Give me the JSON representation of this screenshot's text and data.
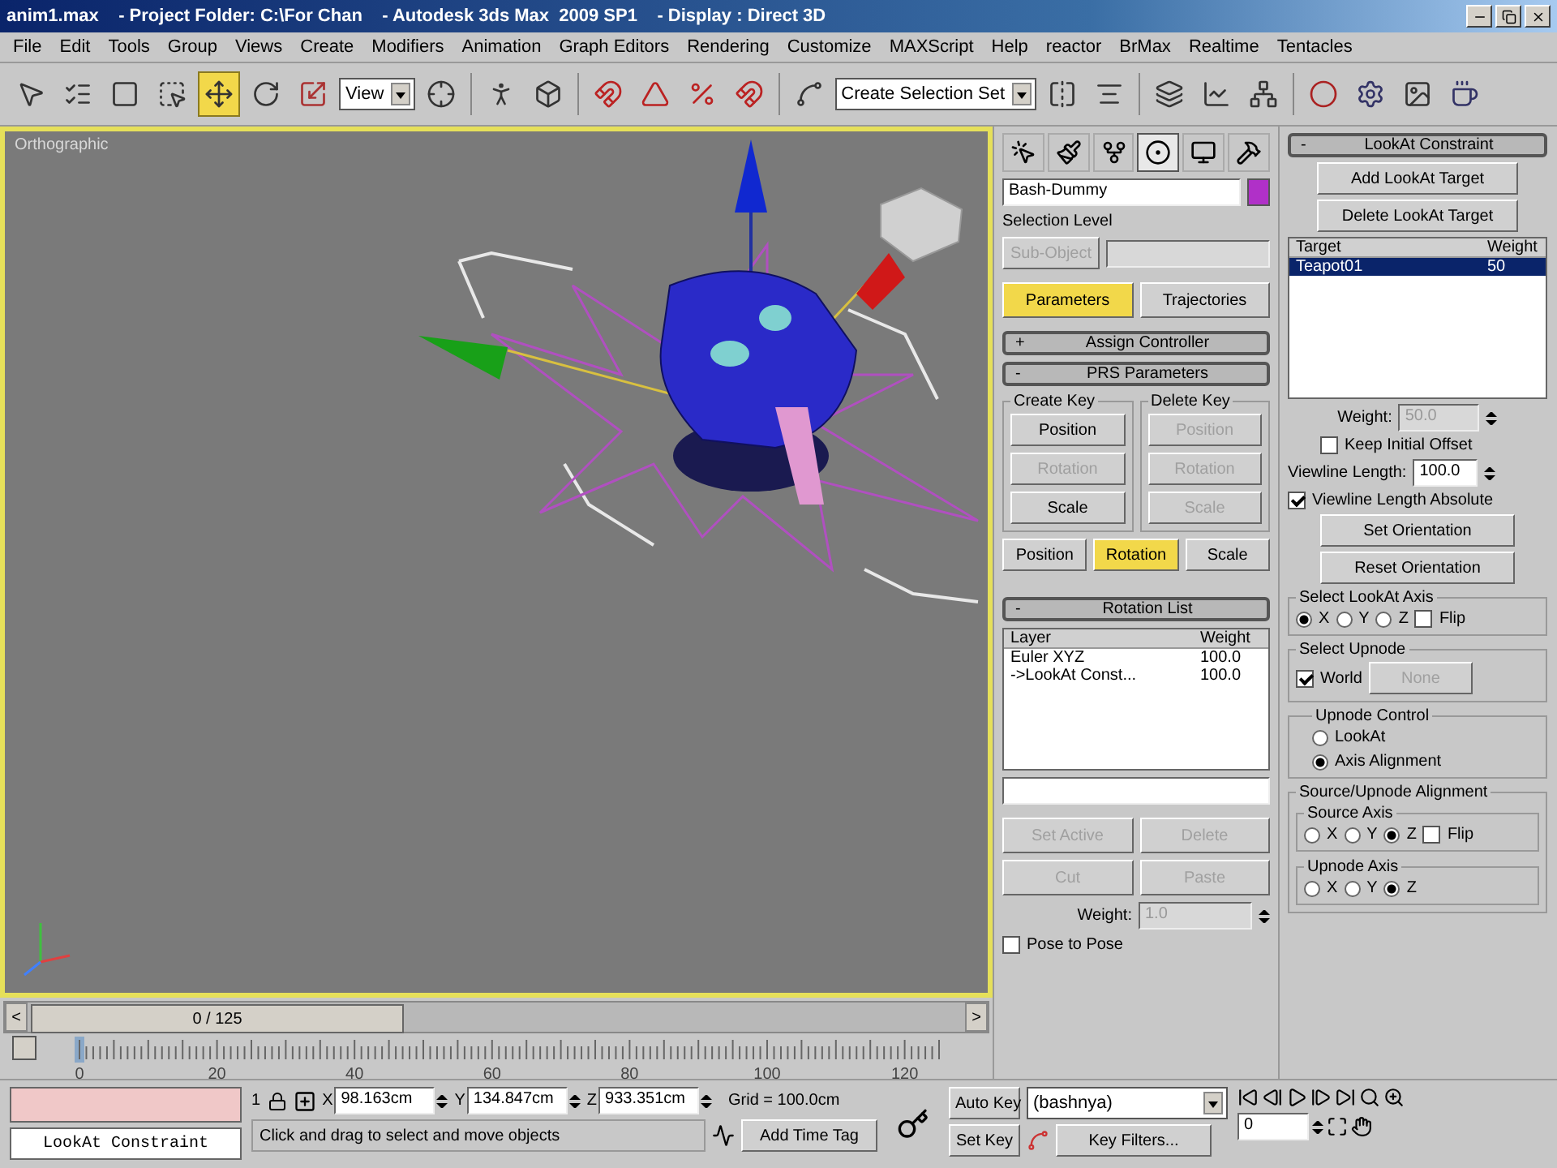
{
  "window": {
    "title": "anim1.max    - Project Folder: C:\\For Chan    - Autodesk 3ds Max  2009 SP1    - Display : Direct 3D"
  },
  "menu": [
    "File",
    "Edit",
    "Tools",
    "Group",
    "Views",
    "Create",
    "Modifiers",
    "Animation",
    "Graph Editors",
    "Rendering",
    "Customize",
    "MAXScript",
    "Help",
    "reactor",
    "BrMax",
    "Realtime",
    "Tentacles"
  ],
  "toolbar": [
    {
      "kind": "tool",
      "selected": false
    },
    {
      "kind": "tool",
      "selected": false
    },
    {
      "kind": "tool",
      "selected": false
    },
    {
      "kind": "tool",
      "selected": false
    },
    {
      "kind": "tool",
      "selected": true
    },
    {
      "kind": "tool",
      "selected": false
    },
    {
      "kind": "tool",
      "selected": false
    },
    {
      "kind": "dropdown",
      "value": "View"
    },
    {
      "kind": "tool",
      "selected": false
    },
    {
      "kind": "separator"
    },
    {
      "kind": "tool",
      "selected": false
    },
    {
      "kind": "tool",
      "selected": false
    },
    {
      "kind": "separator"
    },
    {
      "kind": "tool",
      "selected": false
    },
    {
      "kind": "tool",
      "selected": false
    },
    {
      "kind": "tool",
      "selected": false
    },
    {
      "kind": "tool",
      "selected": false
    },
    {
      "kind": "separator"
    },
    {
      "kind": "tool",
      "selected": false
    },
    {
      "kind": "dropdown",
      "value": "Create Selection Set"
    },
    {
      "kind": "tool",
      "selected": false
    },
    {
      "kind": "tool",
      "selected": false
    },
    {
      "kind": "separator"
    },
    {
      "kind": "tool",
      "selected": false
    },
    {
      "kind": "tool",
      "selected": false
    },
    {
      "kind": "tool",
      "selected": false
    },
    {
      "kind": "separator"
    },
    {
      "kind": "tool",
      "selected": false
    },
    {
      "kind": "tool",
      "selected": false
    },
    {
      "kind": "tool",
      "selected": false
    },
    {
      "kind": "tool",
      "selected": false
    }
  ],
  "viewport": {
    "label": "Orthographic"
  },
  "time_slider": {
    "label": "0 / 125",
    "level": 0,
    "prev": "<",
    "next": ">"
  },
  "track_bar": {
    "ticks": [
      "0",
      "20",
      "40",
      "60",
      "80",
      "100",
      "120"
    ]
  },
  "command_panel": {
    "tabs": [
      {
        "selected": false
      },
      {
        "selected": false
      },
      {
        "selected": false
      },
      {
        "selected": true
      },
      {
        "selected": false
      },
      {
        "selected": false
      }
    ],
    "object_name": "Bash-Dummy",
    "selection_level": "Selection Level",
    "sub_object": "Sub-Object",
    "modes": [
      {
        "label": "Parameters",
        "selected": true
      },
      {
        "label": "Trajectories",
        "selected": false
      }
    ],
    "assign_controller": {
      "sign": "+",
      "title": "Assign Controller"
    },
    "prs": {
      "sign": "-",
      "title": "PRS Parameters",
      "groups": [
        {
          "title": "Create Key",
          "buttons": [
            {
              "label": "Position",
              "disabled": false
            },
            {
              "label": "Rotation",
              "disabled": true
            },
            {
              "label": "Scale",
              "disabled": false
            }
          ]
        },
        {
          "title": "Delete Key",
          "buttons": [
            {
              "label": "Position",
              "disabled": true
            },
            {
              "label": "Rotation",
              "disabled": true
            },
            {
              "label": "Scale",
              "disabled": true
            }
          ]
        }
      ],
      "tabs": [
        {
          "label": "Position",
          "selected": false
        },
        {
          "label": "Rotation",
          "selected": true
        },
        {
          "label": "Scale",
          "selected": false
        }
      ]
    },
    "rotation_list": {
      "sign": "-",
      "title": "Rotation List",
      "columns": [
        "Layer",
        "Weight"
      ],
      "rows": [
        {
          "layer": "Euler XYZ",
          "weight": "100.0"
        },
        {
          "layer": "->LookAt Const...",
          "weight": "100.0"
        }
      ],
      "buttons": [
        {
          "label": "Set Active",
          "disabled": true
        },
        {
          "label": "Delete",
          "disabled": true
        },
        {
          "label": "Cut",
          "disabled": true
        },
        {
          "label": "Paste",
          "disabled": true
        }
      ],
      "weight_label": "Weight:",
      "weight_value": "1.0",
      "pose_to_pose": {
        "label": "Pose to Pose",
        "checked": false
      }
    }
  },
  "lookat": {
    "sign": "-",
    "title": "LookAt Constraint",
    "buttons": [
      "Add LookAt Target",
      "Delete LookAt Target"
    ],
    "columns": [
      "Target",
      "Weight"
    ],
    "targets": [
      {
        "name": "Teapot01",
        "weight": "50",
        "selected": true
      }
    ],
    "weight_label": "Weight:",
    "weight_value": "50.0",
    "keep_offset": {
      "label": "Keep Initial Offset",
      "checked": false
    },
    "viewline_label": "Viewline Length:",
    "viewline_value": "100.0",
    "viewline_absolute": {
      "label": "Viewline Length Absolute",
      "checked": true
    },
    "actions": [
      "Set Orientation",
      "Reset Orientation"
    ],
    "axis_group": {
      "title": "Select LookAt Axis",
      "axes": [
        {
          "label": "X",
          "selected": true
        },
        {
          "label": "Y",
          "selected": false
        },
        {
          "label": "Z",
          "selected": false
        }
      ],
      "flip": {
        "label": "Flip",
        "checked": false
      }
    },
    "upnode_group": {
      "title": "Select Upnode",
      "world": {
        "label": "World",
        "checked": true
      },
      "none_button": "None"
    },
    "control_group": {
      "title": "Upnode Control",
      "options": [
        {
          "label": "LookAt",
          "selected": false
        },
        {
          "label": "Axis Alignment",
          "selected": true
        }
      ]
    },
    "alignment_group": {
      "title": "Source/Upnode Alignment",
      "source": {
        "title": "Source Axis",
        "axes": [
          {
            "label": "X",
            "selected": false
          },
          {
            "label": "Y",
            "selected": false
          },
          {
            "label": "Z",
            "selected": true
          }
        ],
        "flip": {
          "label": "Flip",
          "checked": false
        }
      },
      "upnode": {
        "title": "Upnode Axis",
        "axes": [
          {
            "label": "X",
            "selected": false
          },
          {
            "label": "Y",
            "selected": false
          },
          {
            "label": "Z",
            "selected": true
          }
        ]
      }
    }
  },
  "status": {
    "controller": "LookAt Constraint",
    "count": "1",
    "coords": [
      {
        "axis": "X",
        "value": "98.163cm"
      },
      {
        "axis": "Y",
        "value": "134.847cm"
      },
      {
        "axis": "Z",
        "value": "933.351cm"
      }
    ],
    "grid": "Grid = 100.0cm",
    "prompt": "Click and drag to select and move objects",
    "time_tag": "Add Time Tag",
    "auto_key": "Auto Key",
    "key_set": "(bashnya)",
    "set_key": "Set Key",
    "key_filters": "Key Filters...",
    "frame": "0"
  }
}
